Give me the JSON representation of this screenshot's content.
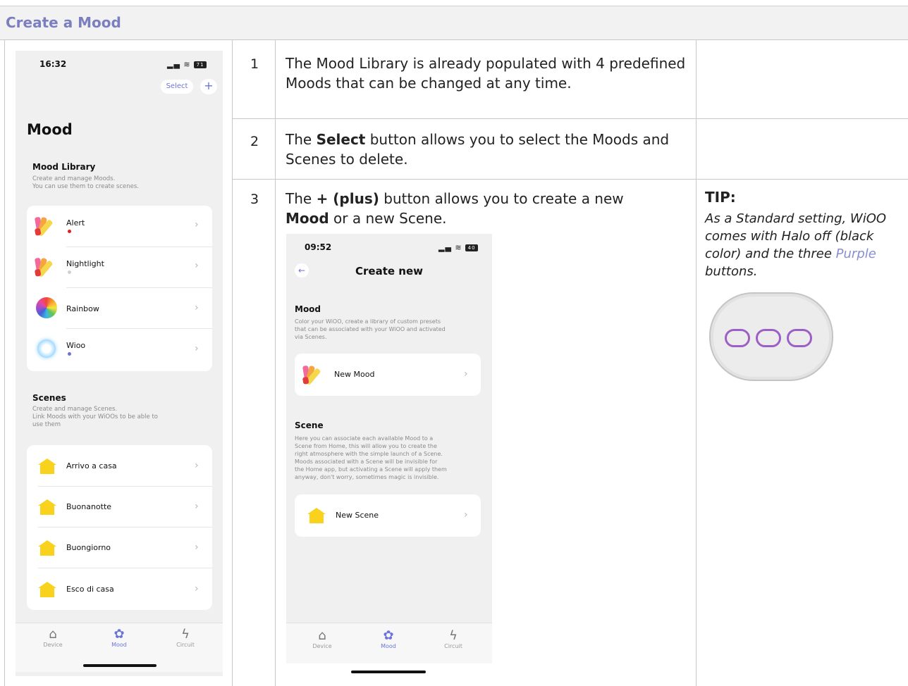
{
  "doc": {
    "title": "Create a Mood"
  },
  "steps": [
    {
      "num": "1",
      "text": "The Mood Library is already populated with 4 predefined Moods that can be changed at any time."
    },
    {
      "num": "2",
      "pre": "The ",
      "bold": "Select",
      "post": " button allows you to select the Moods and Scenes to delete."
    },
    {
      "num": "3",
      "pre": "The ",
      "bold": "+ (plus)",
      "post": " button allows you to create a new ",
      "bold2": "Mood",
      "post2": " or a new Scene."
    }
  ],
  "tip": {
    "heading": "TIP:",
    "line_a": "As a Standard setting, WiOO comes with Halo off (black color) and the three ",
    "purple_word": "Purple",
    "line_b": " buttons."
  },
  "colors": {
    "accent": "#6c74d8",
    "doc_title": "#7b7fc0",
    "device_buttons": "#9b5fc7",
    "house_icon": "#f8d21c"
  },
  "phone1": {
    "time": "16:32",
    "battery": "71",
    "select_label": "Select",
    "plus_label": "+",
    "title": "Mood",
    "library_title": "Mood Library",
    "library_sub_1": "Create and manage Moods.",
    "library_sub_2": "You can use them to create scenes.",
    "moods": [
      {
        "label": "Alert",
        "icon": "palette-fan-icon",
        "dot_color": "#e02020"
      },
      {
        "label": "Nightlight",
        "icon": "palette-fan-icon",
        "dot_color": "#d0d0d0"
      },
      {
        "label": "Rainbow",
        "icon": "color-wheel-icon",
        "dot_color": ""
      },
      {
        "label": "Wioo",
        "icon": "glow-orb-icon",
        "dot_color": "#6c74d8"
      }
    ],
    "scenes_title": "Scenes",
    "scenes_sub_1": "Create and manage Scenes.",
    "scenes_sub_2": "Link Moods with your WiOOs to be able to",
    "scenes_sub_3": "use them",
    "scenes": [
      {
        "label": "Arrivo a casa",
        "icon": "house-icon"
      },
      {
        "label": "Buonanotte",
        "icon": "house-icon"
      },
      {
        "label": "Buongiorno",
        "icon": "house-icon"
      },
      {
        "label": "Esco di casa",
        "icon": "house-icon"
      }
    ],
    "tabs": [
      {
        "label": "Device",
        "icon": "home-icon"
      },
      {
        "label": "Mood",
        "icon": "palette-icon"
      },
      {
        "label": "Circuit",
        "icon": "bolt-icon"
      }
    ]
  },
  "phone2": {
    "time": "09:52",
    "battery": "40",
    "title": "Create new",
    "mood_title": "Mood",
    "mood_sub_1": "Color your WiOO, create a library of custom presets",
    "mood_sub_2": "that can be associated with your WiOO and activated",
    "mood_sub_3": "via Scenes.",
    "new_mood_label": "New Mood",
    "scene_title": "Scene",
    "scene_sub": [
      "Here you can associate each available Mood to a",
      "Scene from Home, this will allow you to create the",
      "right atmosphere with the simple launch of a Scene.",
      "Moods associated with a Scene will be invisible for",
      "the Home app, but activating a Scene will apply them",
      "anyway, don't worry, sometimes magic is invisible."
    ],
    "new_scene_label": "New Scene",
    "tabs": [
      {
        "label": "Device",
        "icon": "home-icon"
      },
      {
        "label": "Mood",
        "icon": "palette-icon"
      },
      {
        "label": "Circuit",
        "icon": "bolt-icon"
      }
    ]
  }
}
